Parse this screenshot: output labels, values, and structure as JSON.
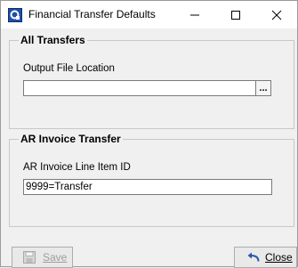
{
  "window": {
    "title": "Financial Transfer Defaults",
    "app_icon": "app-icon",
    "controls": [
      "minimize-icon",
      "maximize-icon",
      "close-icon"
    ]
  },
  "all_transfers": {
    "title": "All Transfers",
    "output_file_label": "Output File Location",
    "output_file_value": "",
    "browse_label": "..."
  },
  "ar_invoice": {
    "title": "AR Invoice Transfer",
    "line_item_label": "AR Invoice Line Item ID",
    "line_item_value": "9999=Transfer"
  },
  "buttons": {
    "save_label": "Save",
    "save_icon": "floppy-disk-icon",
    "save_enabled": false,
    "close_label": "Close",
    "close_icon": "undo-arrow-icon"
  },
  "colors": {
    "app_icon_blue": "#1f4fa8",
    "disabled_text": "#9d9d9d",
    "close_arrow": "#2a56a8"
  }
}
